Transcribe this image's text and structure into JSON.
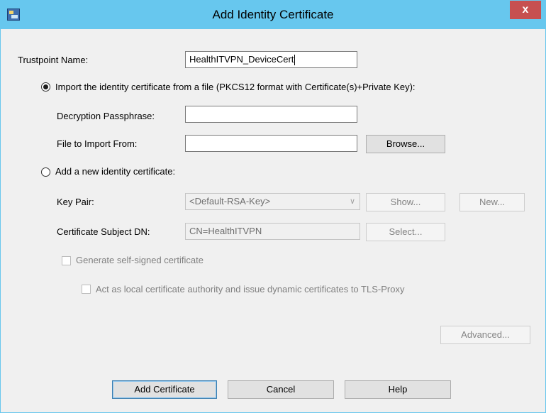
{
  "window": {
    "title": "Add Identity Certificate",
    "close_glyph": "x"
  },
  "trustpoint": {
    "label": "Trustpoint Name:",
    "value": "HealthITVPN_DeviceCert"
  },
  "import_option": {
    "label": "Import the identity certificate from a file (PKCS12 format with Certificate(s)+Private Key):",
    "selected": true,
    "passphrase_label": "Decryption Passphrase:",
    "passphrase_value": "",
    "file_label": "File to Import From:",
    "file_value": "",
    "browse_label": "Browse..."
  },
  "new_option": {
    "label": "Add a new identity certificate:",
    "selected": false,
    "key_pair_label": "Key Pair:",
    "key_pair_value": "<Default-RSA-Key>",
    "show_label": "Show...",
    "new_label": "New...",
    "subject_label": "Certificate Subject DN:",
    "subject_value": "CN=HealthITVPN",
    "select_label": "Select...",
    "self_signed_label": "Generate self-signed certificate",
    "local_ca_label": "Act as local certificate authority and issue dynamic certificates to TLS-Proxy",
    "advanced_label": "Advanced..."
  },
  "footer": {
    "add_label": "Add Certificate",
    "cancel_label": "Cancel",
    "help_label": "Help"
  },
  "icons": {
    "app": "certificate-app-icon",
    "close": "close-icon",
    "dropdown": "chevron-down-icon"
  },
  "colors": {
    "titlebar": "#67c7ee",
    "close": "#c75050",
    "dialog_bg": "#f0f0f0"
  }
}
